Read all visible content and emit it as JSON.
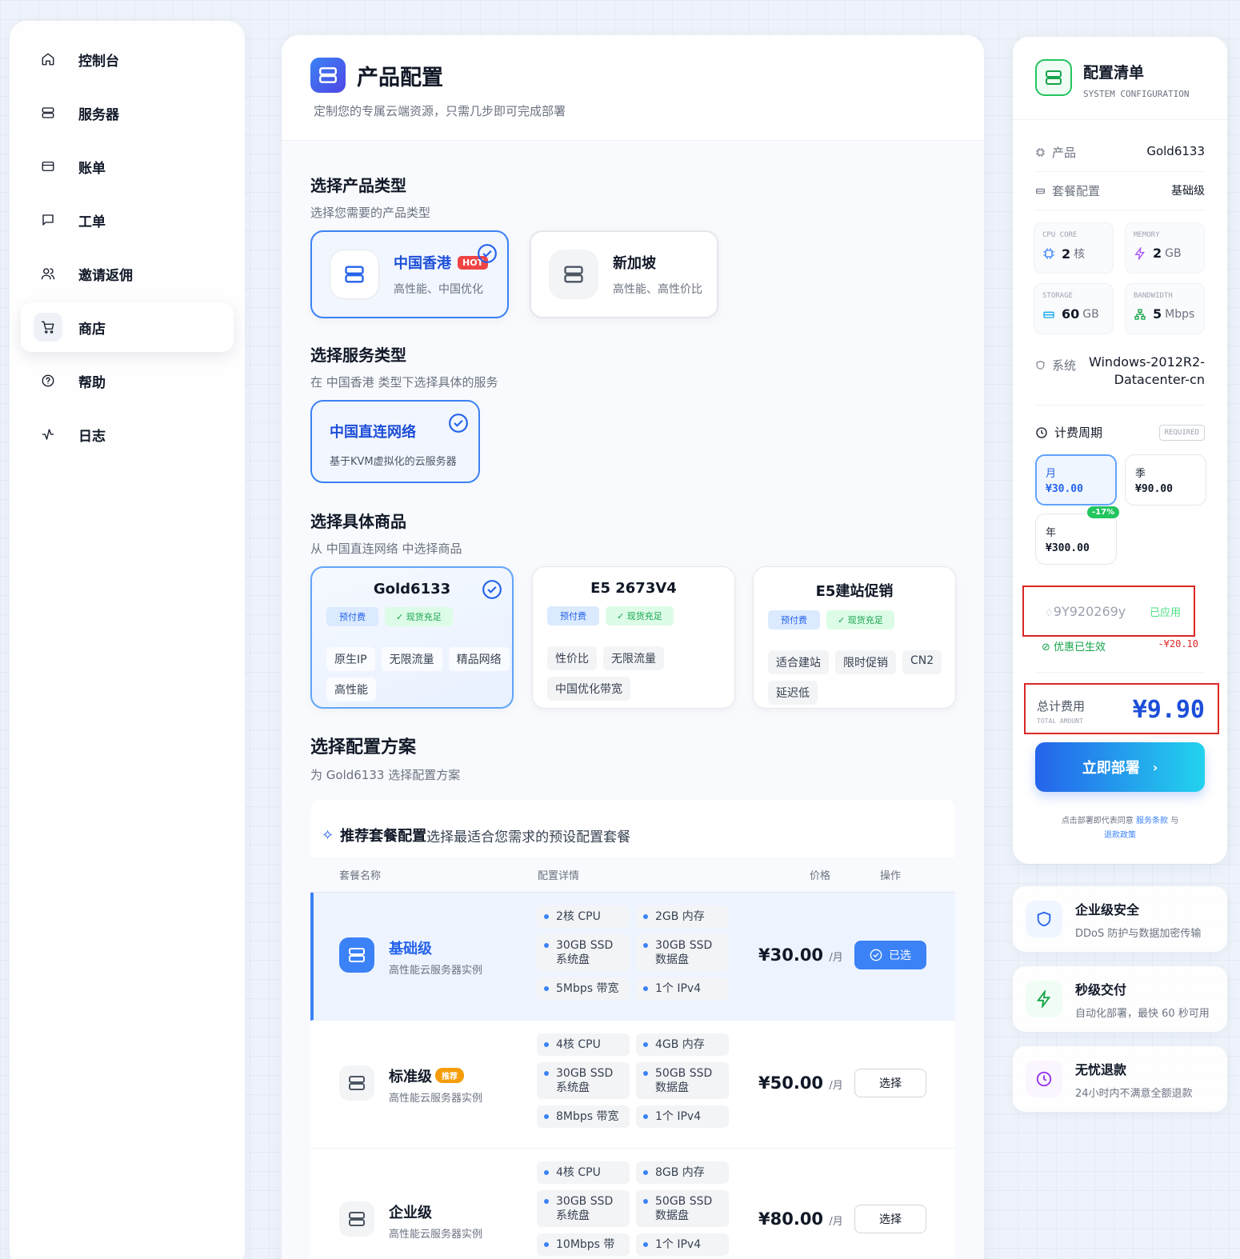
{
  "sidebar": {
    "items": [
      {
        "label": "控制台",
        "icon": "home-icon"
      },
      {
        "label": "服务器",
        "icon": "server-icon"
      },
      {
        "label": "账单",
        "icon": "credit-card-icon"
      },
      {
        "label": "工单",
        "icon": "message-square-icon"
      },
      {
        "label": "邀请返佣",
        "icon": "users-icon"
      },
      {
        "label": "商店",
        "icon": "shopping-cart-icon",
        "active": true
      },
      {
        "label": "帮助",
        "icon": "help-circle-icon"
      },
      {
        "label": "日志",
        "icon": "activity-icon"
      }
    ]
  },
  "header": {
    "title": "产品配置",
    "subtitle": "定制您的专属云端资源，只需几步即可完成部署"
  },
  "product_type": {
    "title": "选择产品类型",
    "subtitle": "选择您需要的产品类型",
    "options": [
      {
        "name": "中国香港",
        "badge": "HOT",
        "desc": "高性能、中国优化",
        "selected": true
      },
      {
        "name": "新加坡",
        "desc": "高性能、高性价比",
        "selected": false
      }
    ]
  },
  "service_type": {
    "title": "选择服务类型",
    "subtitle": "在 中国香港 类型下选择具体的服务",
    "option": {
      "name": "中国直连网络",
      "desc": "基于KVM虚拟化的云服务器"
    }
  },
  "goods": {
    "title": "选择具体商品",
    "subtitle": "从 中国直连网络 中选择商品",
    "items": [
      {
        "name": "Gold6133",
        "badge1": "预付费",
        "badge2": "现货充足",
        "tags": [
          "原生IP",
          "无限流量",
          "精品网络",
          "高性能"
        ],
        "selected": true
      },
      {
        "name": "E5 2673V4",
        "badge1": "预付费",
        "badge2": "现货充足",
        "tags": [
          "性价比",
          "无限流量",
          "中国优化带宽"
        ]
      },
      {
        "name": "E5建站促销",
        "badge1": "预付费",
        "badge2": "现货充足",
        "tags": [
          "适合建站",
          "限时促销",
          "CN2",
          "延迟低"
        ]
      }
    ]
  },
  "plans": {
    "title": "选择配置方案",
    "subtitle": "为 Gold6133 选择配置方案",
    "rec_title": "推荐套餐配置",
    "rec_sub": "选择最适合您需求的预设配置套餐",
    "headers": {
      "name": "套餐名称",
      "detail": "配置详情",
      "price": "价格",
      "action": "操作"
    },
    "rows": [
      {
        "name": "基础级",
        "desc": "高性能云服务器实例",
        "specs": [
          "2核 CPU",
          "2GB 内存",
          "30GB SSD 系统盘",
          "30GB SSD 数据盘",
          "5Mbps 带宽",
          "1个 IPv4"
        ],
        "price": "¥30.00",
        "unit": "/月",
        "action": "已选",
        "selected": true
      },
      {
        "name": "标准级",
        "badge": "推荐",
        "desc": "高性能云服务器实例",
        "specs": [
          "4核 CPU",
          "4GB 内存",
          "30GB SSD 系统盘",
          "50GB SSD 数据盘",
          "8Mbps 带宽",
          "1个 IPv4"
        ],
        "price": "¥50.00",
        "unit": "/月",
        "action": "选择"
      },
      {
        "name": "企业级",
        "desc": "高性能云服务器实例",
        "specs": [
          "4核 CPU",
          "8GB 内存",
          "30GB SSD 系统盘",
          "50GB SSD 数据盘",
          "10Mbps 带",
          "1个 IPv4"
        ],
        "price": "¥80.00",
        "unit": "/月",
        "action": "选择"
      }
    ]
  },
  "summary": {
    "title": "配置清单",
    "subtitle": "SYSTEM CONFIGURATION",
    "product_label": "产品",
    "product_value": "Gold6133",
    "plan_label": "套餐配置",
    "plan_value": "基础级",
    "cpu": {
      "label": "CPU CORE",
      "value": "2",
      "unit": "核"
    },
    "memory": {
      "label": "MEMORY",
      "value": "2",
      "unit": "GB"
    },
    "storage": {
      "label": "STORAGE",
      "value": "60",
      "unit": "GB"
    },
    "bandwidth": {
      "label": "BANDWIDTH",
      "value": "5",
      "unit": "Mbps"
    },
    "os_label": "系统",
    "os_value_line1": "Windows-2012R2-",
    "os_value_line2": "Datacenter-cn",
    "cycle_label": "计费周期",
    "required": "REQUIRED",
    "cycles": [
      {
        "name": "月",
        "price": "¥30.00",
        "selected": true
      },
      {
        "name": "季",
        "price": "¥90.00"
      },
      {
        "name": "年",
        "price": "¥300.00",
        "discount": "-17%"
      }
    ],
    "coupon_code": "9Y920269y",
    "coupon_status": "已应用",
    "coupon_effect": "优惠已生效",
    "coupon_amount": "-¥20.10",
    "total_label": "总计费用",
    "total_label_en": "TOTAL AMOUNT",
    "total_amount": "¥9.90",
    "deploy_label": "立即部署",
    "terms_prefix": "点击部署即代表同意",
    "terms_link1": "服务条款",
    "terms_and": "与",
    "terms_link2": "退款政策"
  },
  "features": [
    {
      "title": "企业级安全",
      "desc": "DDoS 防护与数据加密传输",
      "icon": "shield-icon",
      "color": "#2563eb"
    },
    {
      "title": "秒级交付",
      "desc": "自动化部署，最快 60 秒可用",
      "icon": "zap-icon",
      "color": "#16a34a"
    },
    {
      "title": "无忧退款",
      "desc": "24小时内不满意全额退款",
      "icon": "clock-icon",
      "color": "#9333ea"
    }
  ]
}
